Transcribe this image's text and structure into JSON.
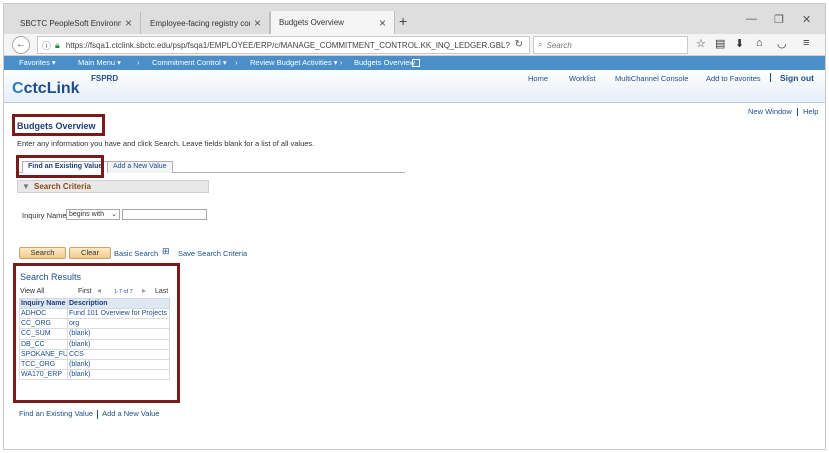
{
  "browser": {
    "tabs": [
      {
        "title": "SBCTC PeopleSoft Environme..."
      },
      {
        "title": "Employee-facing registry cont..."
      },
      {
        "title": "Budgets Overview"
      }
    ],
    "url": "https://fsqa1.ctclink.sbctc.edu/psp/fsqa1/EMPLOYEE/ERP/c/MANAGE_COMMITMENT_CONTROL.KK_INQ_LEDGER.GBL?",
    "search_placeholder": "Search"
  },
  "ps_menu": {
    "favorites": "Favorites ▾",
    "main_menu": "Main Menu ▾",
    "commitment_control": "Commitment Control ▾",
    "review_budget": "Review Budget Activities ▾",
    "current": "Budgets Overview"
  },
  "header": {
    "logo_c": "C",
    "logo_text": "ctcLink",
    "environment": "FSPRD",
    "links": {
      "home": "Home",
      "worklist": "Worklist",
      "multichannel": "MultiChannel Console",
      "add_favorites": "Add to Favorites",
      "sign_out": "Sign out"
    }
  },
  "page": {
    "new_window": "New Window",
    "help": "Help",
    "title": "Budgets Overview",
    "instructions": "Enter any information you have and click Search. Leave fields blank for a list of all values.",
    "tabs": {
      "find": "Find an Existing Value",
      "add": "Add a New Value"
    },
    "criteria_title": "Search Criteria",
    "inquiry_label": "Inquiry Name:",
    "operator": "begins with",
    "buttons": {
      "search": "Search",
      "clear": "Clear",
      "basic_search": "Basic Search",
      "save_criteria": "Save Search Criteria"
    }
  },
  "results": {
    "title": "Search Results",
    "view_all": "View All",
    "first": "First",
    "range": "1-7 of 7",
    "last": "Last",
    "columns": [
      "Inquiry Name",
      "Description"
    ],
    "rows": [
      [
        "ADHOC",
        "Fund 101 Overview for Projects"
      ],
      [
        "CC_ORG",
        "org"
      ],
      [
        "CC_SUM",
        "(blank)"
      ],
      [
        "DB_CC",
        "(blank)"
      ],
      [
        "SPOKANE_FU",
        "CCS"
      ],
      [
        "TCC_ORG",
        "(blank)"
      ],
      [
        "WA170_ERP",
        "(blank)"
      ]
    ]
  },
  "bottom": {
    "find": "Find an Existing Value",
    "add": "Add a New Value"
  }
}
